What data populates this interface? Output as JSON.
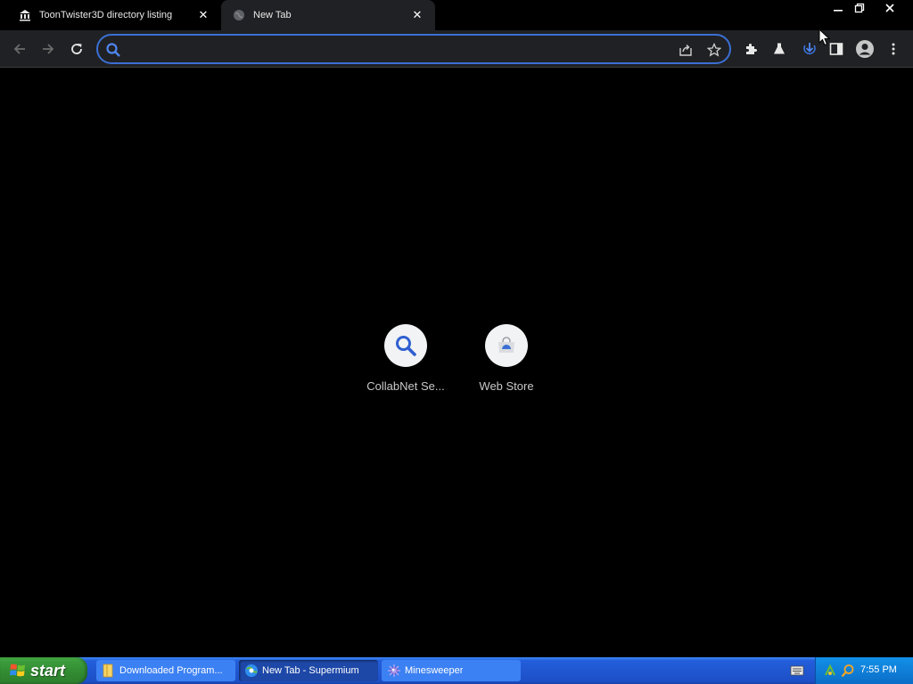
{
  "browser": {
    "tabs": [
      {
        "label": "ToonTwister3D directory listing",
        "icon": "bank-icon",
        "active": false
      },
      {
        "label": "New Tab",
        "icon": "globe-icon",
        "active": true
      }
    ],
    "tab_close_glyph": "✕",
    "omnibox": {
      "value": "",
      "placeholder": ""
    }
  },
  "new_tab": {
    "shortcuts": [
      {
        "label": "CollabNet Se...",
        "icon": "search-icon"
      },
      {
        "label": "Web Store",
        "icon": "web-store-icon"
      }
    ]
  },
  "taskbar": {
    "start_label": "start",
    "tasks": [
      {
        "label": "Downloaded Program...",
        "icon": "folder-icon"
      },
      {
        "label": "New Tab - Supermium",
        "icon": "browser-icon"
      },
      {
        "label": "Minesweeper",
        "icon": "minesweeper-icon"
      }
    ],
    "clock": "7:55 PM"
  },
  "colors": {
    "accent": "#3b6fd4",
    "toolbar": "#202124",
    "taskbar": "#245edb",
    "start": "#318a31"
  }
}
